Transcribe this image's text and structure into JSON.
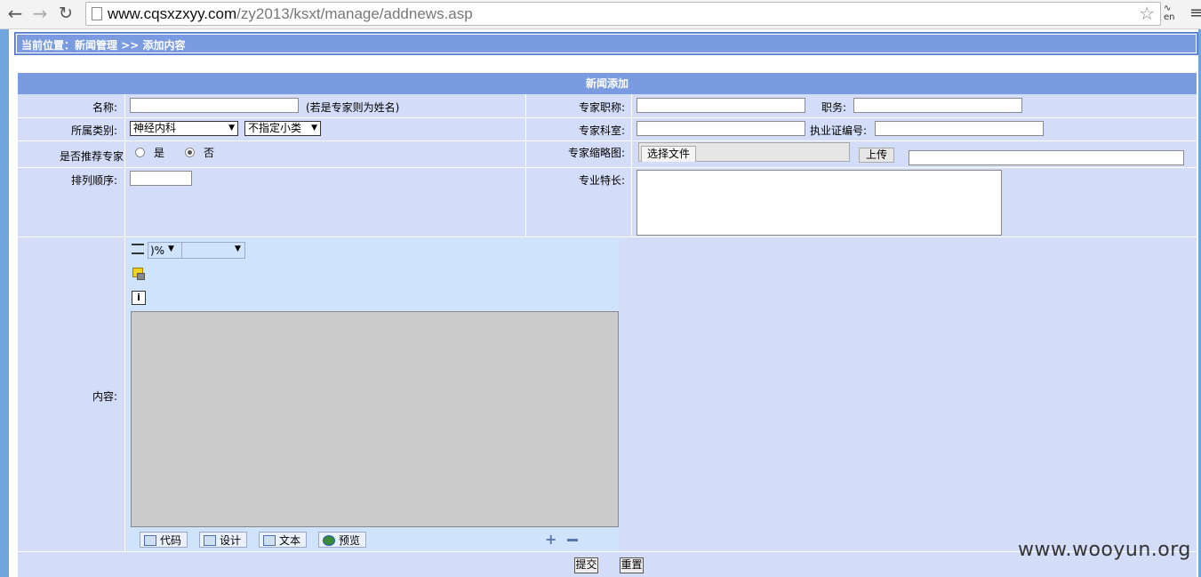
{
  "browser": {
    "url_domain": "www.cqsxzxyy.com",
    "url_path": "/zy2013/ksxt/manage/addnews.asp"
  },
  "breadcrumb": "当前位置：新闻管理 >> 添加内容",
  "form": {
    "header": "新闻添加",
    "name_label": "名称:",
    "name_hint": "(若是专家则为姓名)",
    "title_label": "专家职称:",
    "duty_label": "职务:",
    "category_label": "所属类别:",
    "category_value": "神经内科",
    "subcategory_value": "不指定小类",
    "dept_label": "专家科室:",
    "license_label": "执业证编号:",
    "recommend_label": "是否推荐专家",
    "radio_yes": "是",
    "radio_no": "否",
    "recommend_selected": "否",
    "thumb_label": "专家缩略图:",
    "choose_file": "选择文件",
    "upload": "上传",
    "order_label": "排列顺序:",
    "specialty_label": "专业特长:",
    "content_label": "内容:",
    "zoom_value": ")%",
    "submit": "提交",
    "reset": "重置"
  },
  "editor": {
    "tabs": [
      "代码",
      "设计",
      "文本",
      "预览"
    ]
  },
  "watermark": "www.wooyun.org"
}
